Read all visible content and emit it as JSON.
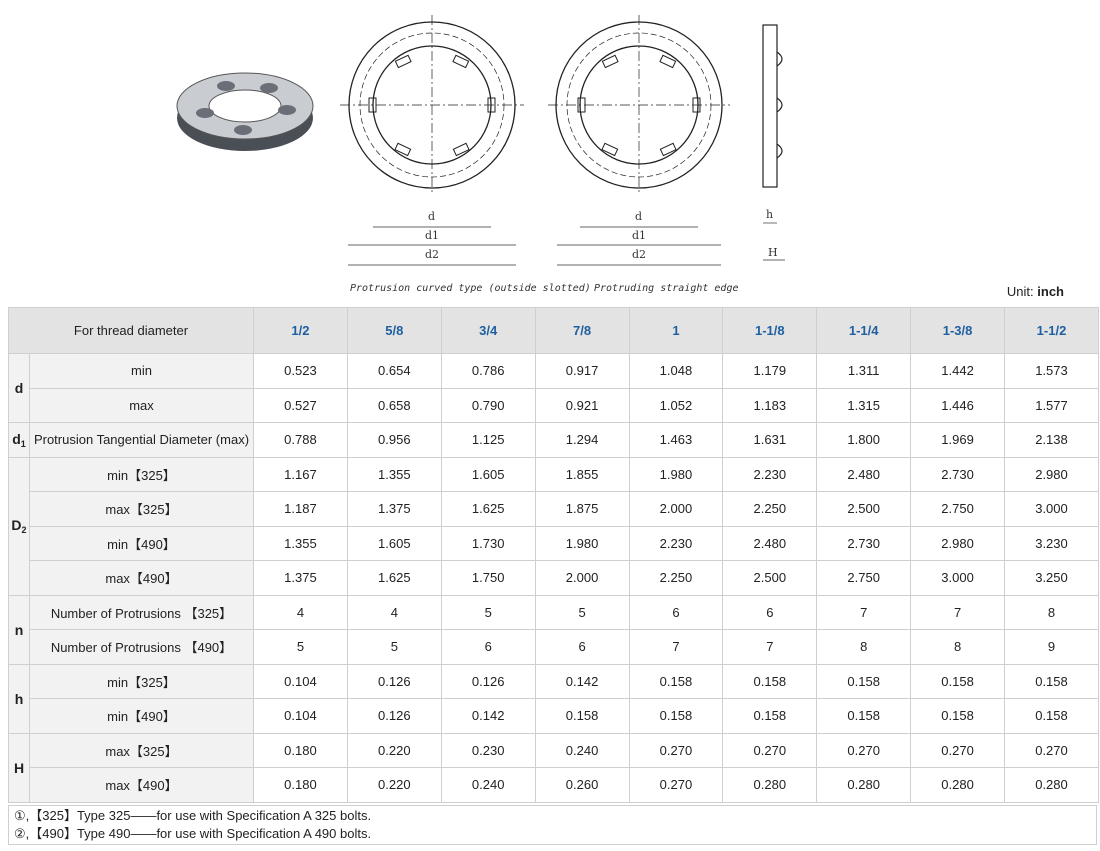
{
  "captions": {
    "curved": "Protrusion curved type (outside slotted)",
    "straight": "Protruding straight edge"
  },
  "dim_labels": {
    "d": "d",
    "d1": "d1",
    "d2": "d2",
    "h": "h",
    "H": "H"
  },
  "unit": {
    "label": "Unit:",
    "value": "inch"
  },
  "table": {
    "header_label": "For thread diameter",
    "sizes": [
      "1/2",
      "5/8",
      "3/4",
      "7/8",
      "1",
      "1-1/8",
      "1-1/4",
      "1-3/8",
      "1-1/2"
    ],
    "groups": [
      {
        "symbol": "d",
        "rows": [
          {
            "label": "min",
            "values": [
              "0.523",
              "0.654",
              "0.786",
              "0.917",
              "1.048",
              "1.179",
              "1.311",
              "1.442",
              "1.573"
            ]
          },
          {
            "label": "max",
            "values": [
              "0.527",
              "0.658",
              "0.790",
              "0.921",
              "1.052",
              "1.183",
              "1.315",
              "1.446",
              "1.577"
            ]
          }
        ]
      },
      {
        "symbol": "d",
        "sub": "1",
        "rows": [
          {
            "label": "Protrusion Tangential Diameter (max)",
            "values": [
              "0.788",
              "0.956",
              "1.125",
              "1.294",
              "1.463",
              "1.631",
              "1.800",
              "1.969",
              "2.138"
            ]
          }
        ]
      },
      {
        "symbol": "D",
        "sub": "2",
        "rows": [
          {
            "label": "min【325】",
            "values": [
              "1.167",
              "1.355",
              "1.605",
              "1.855",
              "1.980",
              "2.230",
              "2.480",
              "2.730",
              "2.980"
            ]
          },
          {
            "label": "max【325】",
            "values": [
              "1.187",
              "1.375",
              "1.625",
              "1.875",
              "2.000",
              "2.250",
              "2.500",
              "2.750",
              "3.000"
            ]
          },
          {
            "label": "min【490】",
            "values": [
              "1.355",
              "1.605",
              "1.730",
              "1.980",
              "2.230",
              "2.480",
              "2.730",
              "2.980",
              "3.230"
            ]
          },
          {
            "label": "max【490】",
            "values": [
              "1.375",
              "1.625",
              "1.750",
              "2.000",
              "2.250",
              "2.500",
              "2.750",
              "3.000",
              "3.250"
            ]
          }
        ]
      },
      {
        "symbol": "n",
        "rows": [
          {
            "label": "Number of Protrusions 【325】",
            "values": [
              "4",
              "4",
              "5",
              "5",
              "6",
              "6",
              "7",
              "7",
              "8"
            ]
          },
          {
            "label": "Number of Protrusions 【490】",
            "values": [
              "5",
              "5",
              "6",
              "6",
              "7",
              "7",
              "8",
              "8",
              "9"
            ]
          }
        ]
      },
      {
        "symbol": "h",
        "rows": [
          {
            "label": "min【325】",
            "values": [
              "0.104",
              "0.126",
              "0.126",
              "0.142",
              "0.158",
              "0.158",
              "0.158",
              "0.158",
              "0.158"
            ]
          },
          {
            "label": "min【490】",
            "values": [
              "0.104",
              "0.126",
              "0.142",
              "0.158",
              "0.158",
              "0.158",
              "0.158",
              "0.158",
              "0.158"
            ]
          }
        ]
      },
      {
        "symbol": "H",
        "rows": [
          {
            "label": "max【325】",
            "values": [
              "0.180",
              "0.220",
              "0.230",
              "0.240",
              "0.270",
              "0.270",
              "0.270",
              "0.270",
              "0.270"
            ]
          },
          {
            "label": "max【490】",
            "values": [
              "0.180",
              "0.220",
              "0.240",
              "0.260",
              "0.270",
              "0.280",
              "0.280",
              "0.280",
              "0.280"
            ]
          }
        ]
      }
    ]
  },
  "notes": [
    "①,【325】Type 325——for use with Specification A 325 bolts.",
    "②,【490】Type 490——for use with Specification A 490 bolts."
  ]
}
